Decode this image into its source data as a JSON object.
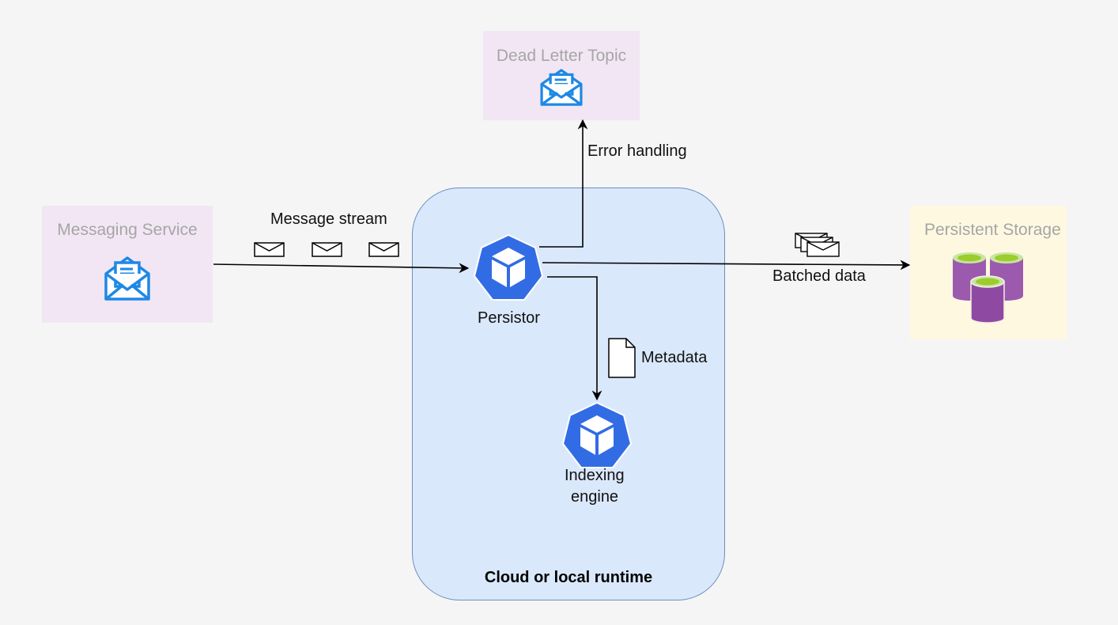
{
  "nodes": {
    "messaging_service": {
      "label": "Messaging Service",
      "icon": "envelope-document-icon"
    },
    "dead_letter_topic": {
      "label": "Dead Letter Topic",
      "icon": "envelope-document-icon"
    },
    "persistent_storage": {
      "label": "Persistent Storage",
      "icon": "database-cylinders-icon"
    },
    "runtime": {
      "label": "Cloud or local runtime"
    },
    "persistor": {
      "label": "Persistor",
      "icon": "kubernetes-cube-icon"
    },
    "indexing_engine": {
      "label_line1": "Indexing",
      "label_line2": "engine",
      "icon": "kubernetes-cube-icon"
    }
  },
  "edges": {
    "message_stream": "Message stream",
    "error_handling": "Error handling",
    "batched_data": "Batched data",
    "metadata": "Metadata"
  },
  "colors": {
    "background": "#f5f5f5",
    "purple_box": "#f2e6f4",
    "yellow_box": "#fff8e1",
    "runtime_fill": "#dae8fc",
    "runtime_stroke": "#6c8ebf",
    "k8s_blue": "#326ce5",
    "envelope_blue": "#1e88e5",
    "db_purple": "#9c5aae",
    "db_green": "#9ccc2e",
    "muted_label": "#a6a6a6"
  }
}
